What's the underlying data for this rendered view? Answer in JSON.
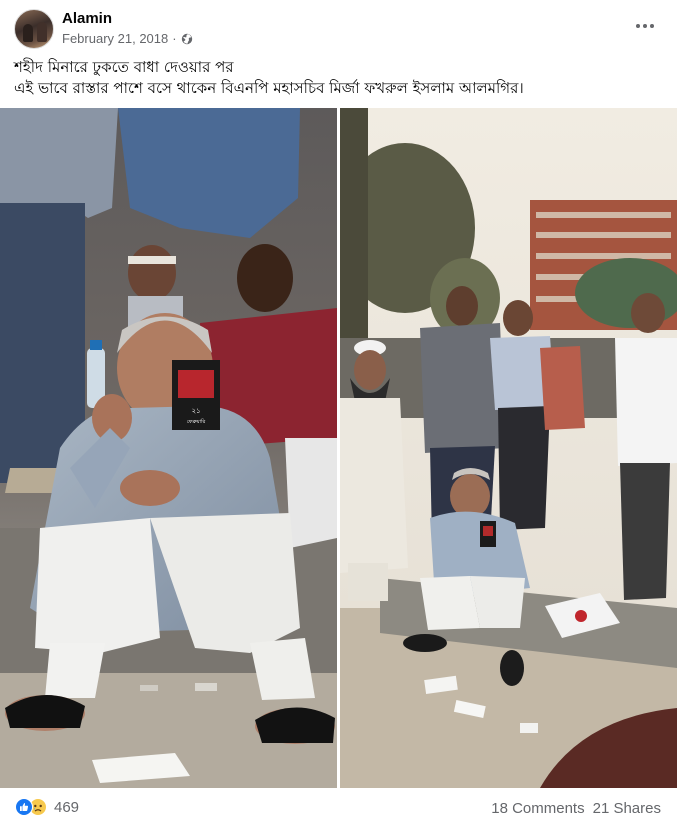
{
  "post": {
    "author": "Alamin",
    "date": "February 21, 2018",
    "privacy_icon": "globe-icon",
    "menu_icon": "more-options-icon",
    "caption_lines": [
      "শহীদ মিনারে ঢুকতে বাধা দেওয়ার পর",
      " এই ভাবে রাস্তার পাশে বসে থাকেন বিএনপি মহাসচিব মির্জা ফখরুল ইসলাম আলমগির।"
    ],
    "photo_left": {
      "badge_lines": [
        "২১",
        "ফেব্রুয়ারি"
      ]
    }
  },
  "footer": {
    "reaction_icons": [
      "like-icon",
      "sad-icon"
    ],
    "reaction_count": "469",
    "comments": "18 Comments",
    "shares": "21 Shares"
  },
  "colors": {
    "link_blue": "#1877f2",
    "secondary_text": "#65676b"
  }
}
